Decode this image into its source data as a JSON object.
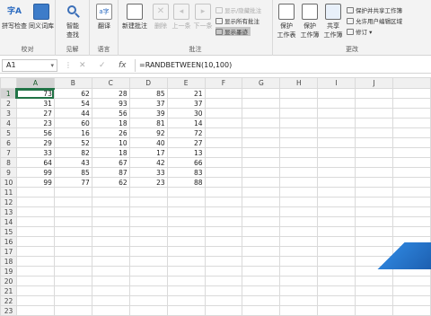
{
  "ribbon": {
    "proofing": {
      "label": "校对",
      "spelling": "拼写检查",
      "thesaurus": "同义词库"
    },
    "insights": {
      "label": "见解",
      "smart_lookup_line1": "智能",
      "smart_lookup_line2": "查找"
    },
    "language": {
      "label": "语言",
      "translate": "翻译"
    },
    "comments": {
      "label": "批注",
      "new_comment": "新建批注",
      "delete": "删除",
      "previous": "上一条",
      "next": "下一条",
      "show_hide": "显示/隐藏批注",
      "show_all": "显示所有批注",
      "show_ink": "显示墨迹"
    },
    "changes": {
      "label": "更改",
      "protect_sheet_line1": "保护",
      "protect_sheet_line2": "工作表",
      "protect_workbook_line1": "保护",
      "protect_workbook_line2": "工作簿",
      "share_workbook_line1": "共享",
      "share_workbook_line2": "工作簿",
      "protect_and_share": "保护并共享工作簿",
      "allow_edit_ranges": "允许用户编辑区域",
      "track_changes": "修订 ▾"
    }
  },
  "formula_bar": {
    "name_box": "A1",
    "name_box_dropdown": "▾",
    "separator": "⋮",
    "cancel": "✕",
    "enter": "✓",
    "fx": "fx",
    "formula": "=RANDBETWEEN(10,100)"
  },
  "grid": {
    "columns": [
      "A",
      "B",
      "C",
      "D",
      "E",
      "F",
      "G",
      "H",
      "I",
      "J"
    ],
    "rows": [
      [
        "73",
        "62",
        "28",
        "85",
        "21"
      ],
      [
        "31",
        "54",
        "93",
        "37",
        "37"
      ],
      [
        "27",
        "44",
        "56",
        "39",
        "30"
      ],
      [
        "23",
        "60",
        "18",
        "81",
        "14"
      ],
      [
        "56",
        "16",
        "26",
        "92",
        "72"
      ],
      [
        "29",
        "52",
        "10",
        "40",
        "27"
      ],
      [
        "33",
        "82",
        "18",
        "17",
        "13"
      ],
      [
        "64",
        "43",
        "67",
        "42",
        "66"
      ],
      [
        "99",
        "85",
        "87",
        "33",
        "83"
      ],
      [
        "99",
        "77",
        "62",
        "23",
        "88"
      ]
    ],
    "row_numbers": [
      "1",
      "2",
      "3",
      "4",
      "5",
      "6",
      "7",
      "8",
      "9",
      "10",
      "11",
      "12",
      "13",
      "14",
      "15",
      "16",
      "17",
      "18",
      "19",
      "20",
      "21",
      "22",
      "23"
    ]
  }
}
